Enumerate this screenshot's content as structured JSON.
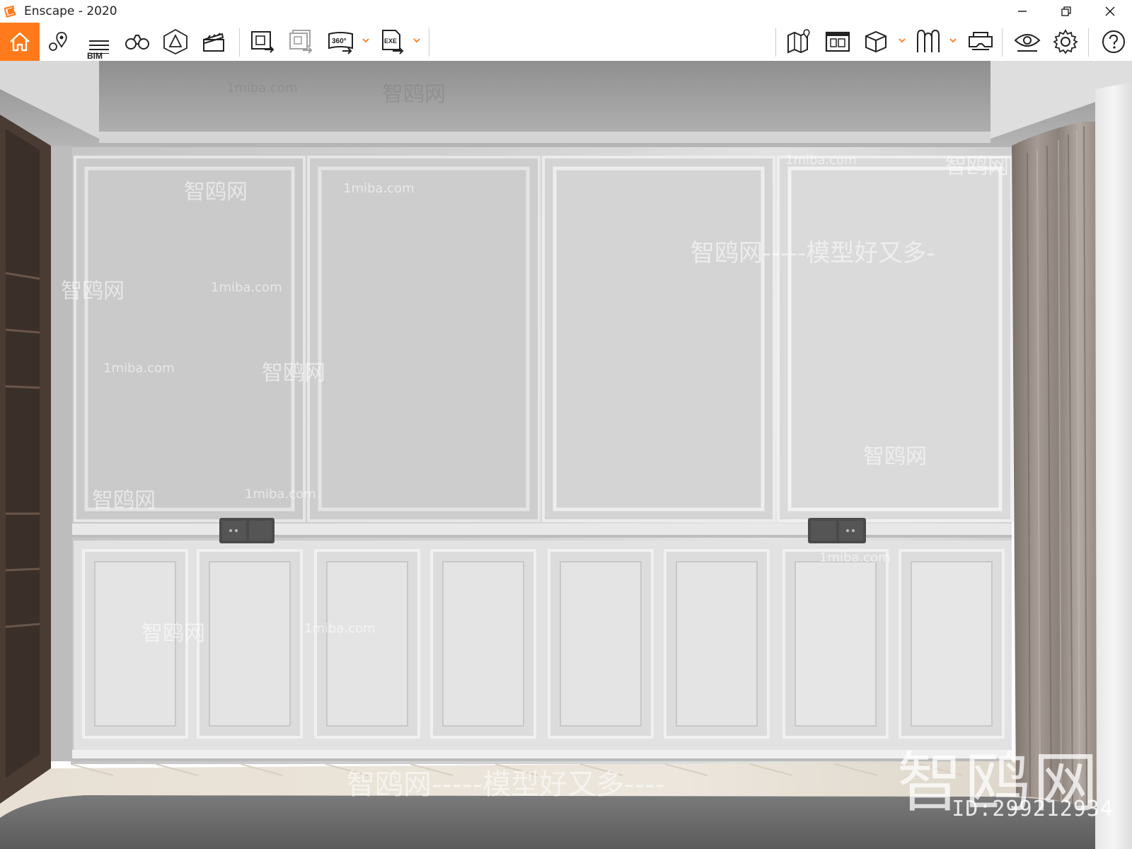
{
  "window": {
    "title": "Enscape - 2020",
    "accent": "#ff7a1a"
  },
  "toolbar": {
    "bim_label": "BIM",
    "tools_left": [
      {
        "name": "home-icon",
        "active": true
      },
      {
        "name": "location-pins-icon"
      },
      {
        "name": "bim-icon"
      },
      {
        "name": "binoculars-icon"
      },
      {
        "name": "perspective-icon"
      },
      {
        "name": "clapperboard-icon"
      },
      {
        "name": "render-screenshot-icon"
      },
      {
        "name": "batch-render-icon"
      },
      {
        "name": "panorama-360-icon"
      },
      {
        "name": "export-exe-icon"
      }
    ],
    "tools_right": [
      {
        "name": "map-icon"
      },
      {
        "name": "views-icon"
      },
      {
        "name": "cube-icon"
      },
      {
        "name": "asset-library-icon"
      },
      {
        "name": "vr-headset-icon"
      },
      {
        "name": "visual-settings-icon"
      },
      {
        "name": "settings-gear-icon"
      },
      {
        "name": "help-icon"
      }
    ]
  },
  "watermarks": {
    "site": "1miba.com",
    "brand": "智鸥网",
    "slogan": "智鸥网-----模型好又多----",
    "slogan_short": "智鸥网-----模型好又多-",
    "big": "智鸥网",
    "id": "ID:299212934"
  }
}
